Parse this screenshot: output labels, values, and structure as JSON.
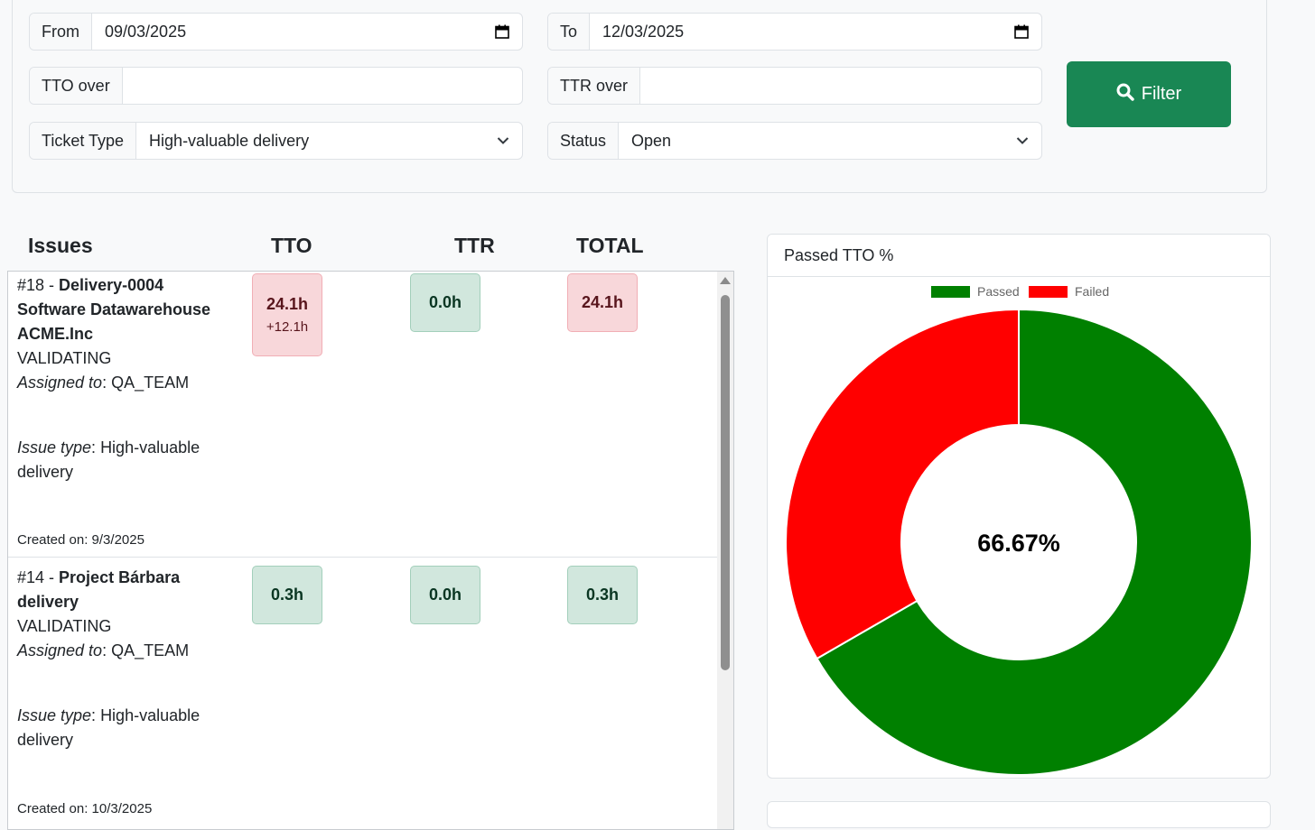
{
  "filters": {
    "from": {
      "label": "From",
      "value": "09/03/2025"
    },
    "to": {
      "label": "To",
      "value": "12/03/2025"
    },
    "tto_over": {
      "label": "TTO over",
      "value": ""
    },
    "ttr_over": {
      "label": "TTR over",
      "value": ""
    },
    "ticket_type": {
      "label": "Ticket Type",
      "value": "High-valuable delivery"
    },
    "status": {
      "label": "Status",
      "value": "Open"
    },
    "filter_button": "Filter"
  },
  "table": {
    "headers": {
      "issues": "Issues",
      "tto": "TTO",
      "ttr": "TTR",
      "total": "TOTAL"
    },
    "assigned_label": "Assigned to",
    "issue_type_label": "Issue type",
    "rows": [
      {
        "id": "#18",
        "title_lines": [
          "Delivery-0004",
          "Software Datawarehouse",
          "ACME.Inc"
        ],
        "status": "VALIDATING",
        "assigned_to": "QA_TEAM",
        "issue_type_lines": [
          "High-valuable",
          "delivery"
        ],
        "created": "Created on: 9/3/2025",
        "tto": {
          "value": "24.1h",
          "extra": "+12.1h",
          "state": "failed"
        },
        "ttr": {
          "value": "0.0h",
          "state": "passed"
        },
        "total": {
          "value": "24.1h",
          "state": "failed"
        }
      },
      {
        "id": "#14",
        "title_lines": [
          "Project Bárbara",
          "delivery"
        ],
        "status": "VALIDATING",
        "assigned_to": "QA_TEAM",
        "issue_type_lines": [
          "High-valuable",
          "delivery"
        ],
        "created": "Created on: 10/3/2025",
        "tto": {
          "value": "0.3h",
          "state": "passed"
        },
        "ttr": {
          "value": "0.0h",
          "state": "passed"
        },
        "total": {
          "value": "0.3h",
          "state": "passed"
        }
      }
    ]
  },
  "chart_card": {
    "title": "Passed TTO %"
  },
  "chart_data": {
    "type": "pie",
    "variant": "doughnut",
    "categories": [
      "Passed",
      "Failed"
    ],
    "values": [
      66.67,
      33.33
    ],
    "colors": [
      "#008000",
      "#ff0000"
    ],
    "center_label": "66.67%",
    "legend_position": "top"
  },
  "colors": {
    "filter_button": "#198754",
    "failed_badge": "#f8d7da",
    "passed_badge": "#d1e7dd"
  },
  "icons": {
    "date": "calendar-icon",
    "select": "chevron-down-icon",
    "filter": "search-icon"
  }
}
